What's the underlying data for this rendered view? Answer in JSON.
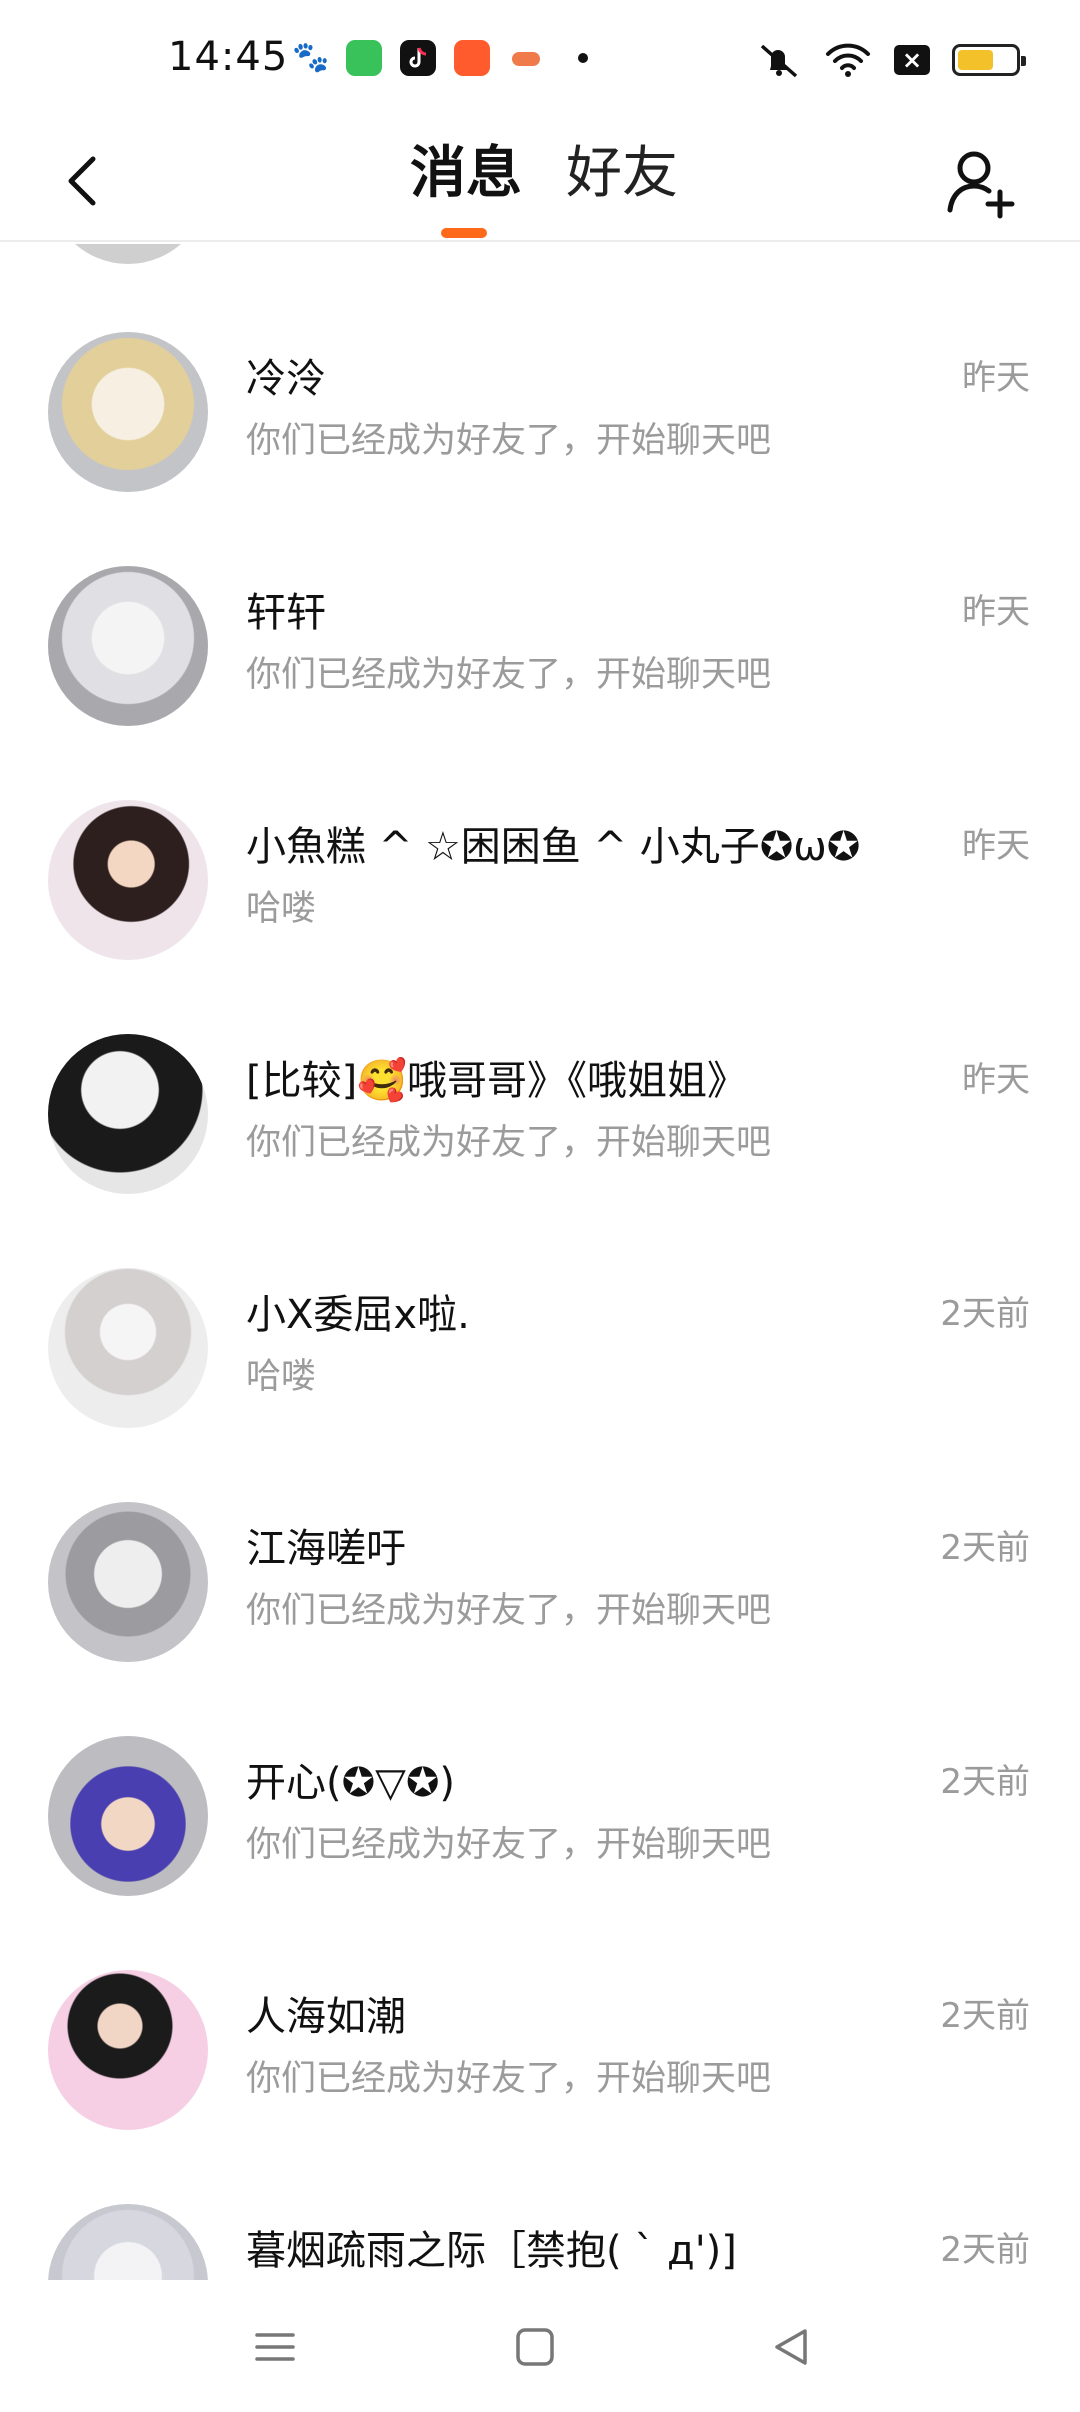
{
  "status_bar": {
    "time": "14:45",
    "apps": [
      "baidu-app-icon",
      "green-app-icon",
      "tiktok-app-icon",
      "orange-app-icon",
      "game-app-icon"
    ],
    "right_icons": [
      "mute-icon",
      "wifi-icon",
      "no-sim-icon",
      "battery-icon"
    ],
    "battery_level": 0.62
  },
  "header": {
    "tabs": [
      {
        "label": "消息",
        "active": true
      },
      {
        "label": "好友",
        "active": false
      }
    ],
    "accent_color": "#ff6a1a"
  },
  "chats": [
    {
      "name": "冷泠",
      "preview": "你们已经成为好友了，开始聊天吧",
      "time": "昨天",
      "avatar": "#c9b89a"
    },
    {
      "name": "轩轩",
      "preview": "你们已经成为好友了，开始聊天吧",
      "time": "昨天",
      "avatar": "#d8d8dc"
    },
    {
      "name": "小魚糕 ^ ☆困困鱼 ^ 小丸子✪ω✪",
      "preview": "哈喽",
      "time": "昨天",
      "avatar": "#3b2a2a"
    },
    {
      "name": "[比较]🥰哦哥哥》《哦姐姐》",
      "preview": "你们已经成为好友了，开始聊天吧",
      "time": "昨天",
      "avatar": "#1e1e1e"
    },
    {
      "name": "小X委屈x啦.",
      "preview": "哈喽",
      "time": "2天前",
      "avatar": "#e3e3e3"
    },
    {
      "name": "江海嗟吁",
      "preview": "你们已经成为好友了，开始聊天吧",
      "time": "2天前",
      "avatar": "#b8b8ba"
    },
    {
      "name": "开心(✪▽✪)",
      "preview": "你们已经成为好友了，开始聊天吧",
      "time": "2天前",
      "avatar": "#5048b8"
    },
    {
      "name": "人海如潮",
      "preview": "你们已经成为好友了，开始聊天吧",
      "time": "2天前",
      "avatar": "#f3cfe2"
    },
    {
      "name": "暮烟疏雨之际［禁抱( ˋ д')]",
      "preview": "",
      "time": "2天前",
      "avatar": "#d8d8e0"
    }
  ]
}
